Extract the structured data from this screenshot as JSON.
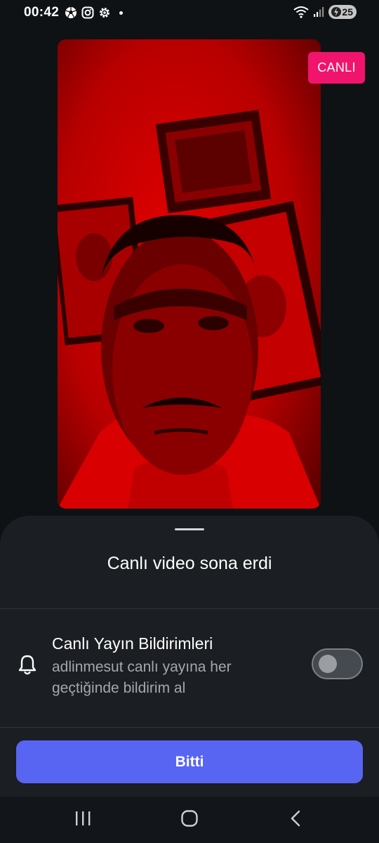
{
  "status_bar": {
    "time": "00:42",
    "battery": "25",
    "left_icons": [
      "soccer-ball-icon",
      "instagram-icon",
      "settings-gear-icon",
      "dot-icon"
    ],
    "right_icons": [
      "wifi-icon",
      "signal-icon",
      "battery-icon"
    ]
  },
  "video": {
    "live_label": "CANLI",
    "tint_color": "#c80000"
  },
  "sheet": {
    "title": "Canlı video sona erdi",
    "notifications": {
      "title": "Canlı Yayın Bildirimleri",
      "subtitle": "adlinmesut canlı yayına her geçtiğinde bildirim al",
      "toggle_on": false
    },
    "done_label": "Bitti"
  },
  "colors": {
    "accent": "#5865f2",
    "live": "#f0146c",
    "sheet_bg": "#1b1e22"
  },
  "nav": {
    "buttons": [
      "recent-apps-icon",
      "home-icon",
      "back-icon"
    ]
  }
}
